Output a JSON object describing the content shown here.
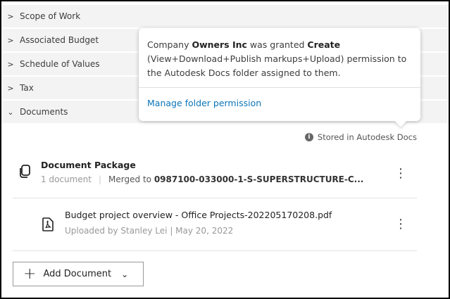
{
  "sections": [
    {
      "label": "Scope of Work",
      "expanded": false
    },
    {
      "label": "Associated Budget",
      "expanded": false
    },
    {
      "label": "Schedule of Values",
      "expanded": false
    },
    {
      "label": "Tax",
      "expanded": false
    },
    {
      "label": "Documents",
      "expanded": true
    }
  ],
  "tooltip": {
    "prefix": "Company ",
    "company": "Owners Inc",
    "mid": " was granted ",
    "permission": "Create",
    "rest": " (View+Download+Publish markups+Upload) permission to the Autodesk Docs folder assigned to them.",
    "link": "Manage folder permission"
  },
  "stored_label": "Stored in Autodesk Docs",
  "package": {
    "title": "Document Package",
    "count": "1 document",
    "merged_prefix": "Merged to ",
    "merged_name": "0987100-033000-1-S-SUPERSTRUCTURE-C..."
  },
  "file": {
    "name": "Budget project overview - Office Projects-202205170208.pdf",
    "meta": "Uploaded by Stanley Lei | May 20, 2022"
  },
  "add_button": "Add Document"
}
